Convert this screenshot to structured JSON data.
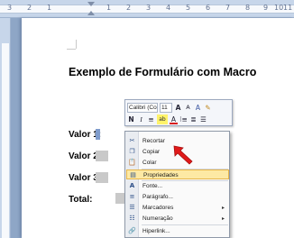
{
  "ruler": {
    "numbers": [
      "3",
      "2",
      "1",
      "1",
      "2",
      "3",
      "4",
      "5",
      "6",
      "7",
      "8",
      "9",
      "10",
      "11"
    ]
  },
  "document": {
    "title": "Exemplo de Formulário com Macro",
    "fields": [
      {
        "label": "Valor 1:"
      },
      {
        "label": "Valor 2:"
      },
      {
        "label": "Valor 3:"
      },
      {
        "label": "Total:"
      }
    ]
  },
  "mini_toolbar": {
    "font_name": "Calibri (Cor",
    "font_size": "11",
    "row1_buttons": [
      "A",
      "A",
      "A",
      "✎"
    ],
    "row2_buttons": [
      "N",
      "I",
      "≡",
      "ab",
      "A",
      "⁝≡",
      "≣",
      "☰"
    ]
  },
  "context_menu": {
    "items": [
      {
        "label": "Recortar",
        "icon": "scissors-icon",
        "glyph": "✂"
      },
      {
        "label": "Copiar",
        "icon": "copy-icon",
        "glyph": "❐"
      },
      {
        "label": "Colar",
        "icon": "paste-icon",
        "glyph": "📋"
      },
      {
        "label": "Propriedades",
        "icon": "properties-icon",
        "glyph": "▤",
        "highlighted": true
      },
      {
        "label": "Fonte...",
        "icon": "font-icon",
        "glyph": "A"
      },
      {
        "label": "Parágrafo...",
        "icon": "paragraph-icon",
        "glyph": "≡"
      },
      {
        "label": "Marcadores",
        "icon": "bullets-icon",
        "glyph": "☰",
        "submenu": true
      },
      {
        "label": "Numeração",
        "icon": "numbering-icon",
        "glyph": "☷",
        "submenu": true
      },
      {
        "label": "Hiperlink...",
        "icon": "hyperlink-icon",
        "glyph": "🔗"
      }
    ],
    "submenu_arrow": "▸"
  },
  "colors": {
    "menu_highlight": "#fde9a4",
    "annotation_arrow": "#e01a1a",
    "app_background": "#8ea6c6"
  }
}
